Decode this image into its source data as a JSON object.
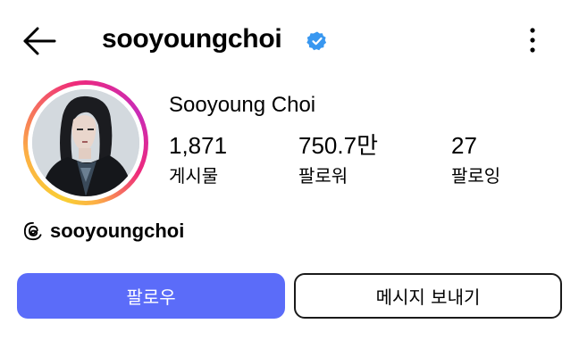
{
  "header": {
    "back_icon": "arrow-left-icon",
    "username": "sooyoungchoi",
    "verified_icon": "verified-badge-icon",
    "more_icon": "more-vertical-icon"
  },
  "profile": {
    "avatar": "profile-photo",
    "display_name": "Sooyoung Choi",
    "stats": [
      {
        "value": "1,871",
        "label": "게시물"
      },
      {
        "value": "750.7만",
        "label": "팔로워"
      },
      {
        "value": "27",
        "label": "팔로잉"
      }
    ],
    "threads": {
      "icon": "threads-icon",
      "handle": "sooyoungchoi"
    }
  },
  "actions": {
    "follow_label": "팔로우",
    "message_label": "메시지 보내기"
  },
  "colors": {
    "follow_button": "#5b6cf9",
    "verified_badge": "#3897f0",
    "ring_gradient": [
      "#f9ce34",
      "#ee2a7b",
      "#c92bb7"
    ]
  }
}
